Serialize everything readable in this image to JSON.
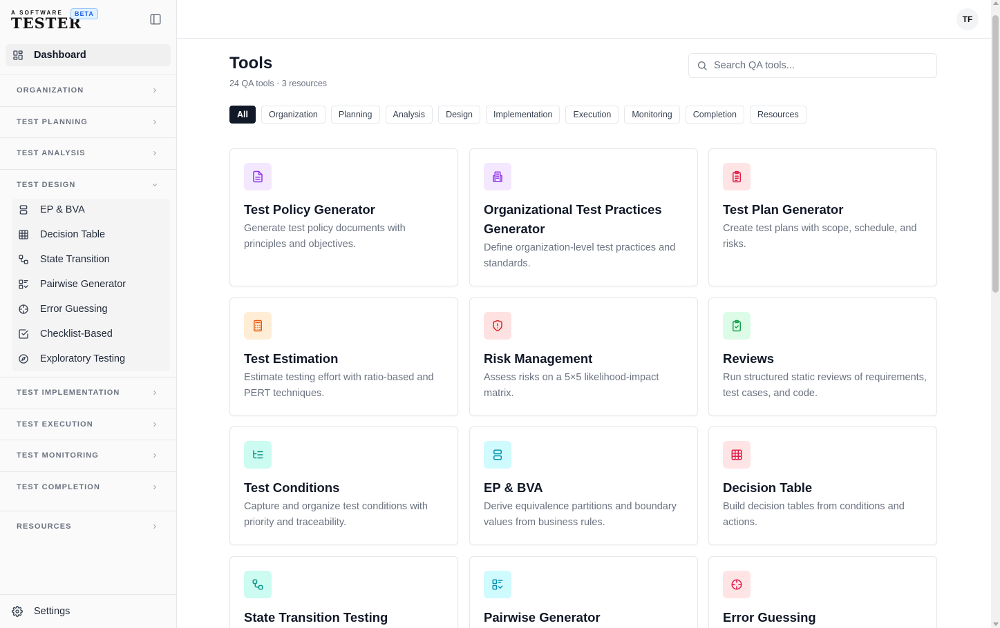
{
  "brand": {
    "top": "A SOFTWARE",
    "main": "TESTER",
    "badge": "BETA"
  },
  "sidebar": {
    "dashboard": "Dashboard",
    "sections": [
      {
        "label": "ORGANIZATION"
      },
      {
        "label": "TEST PLANNING"
      },
      {
        "label": "TEST ANALYSIS"
      },
      {
        "label": "TEST DESIGN"
      },
      {
        "label": "TEST IMPLEMENTATION"
      },
      {
        "label": "TEST EXECUTION"
      },
      {
        "label": "TEST MONITORING"
      },
      {
        "label": "TEST COMPLETION"
      },
      {
        "label": "RESOURCES"
      }
    ],
    "design_items": [
      {
        "label": "EP & BVA"
      },
      {
        "label": "Decision Table"
      },
      {
        "label": "State Transition"
      },
      {
        "label": "Pairwise Generator"
      },
      {
        "label": "Error Guessing"
      },
      {
        "label": "Checklist-Based"
      },
      {
        "label": "Exploratory Testing"
      }
    ],
    "settings": "Settings"
  },
  "header": {
    "avatar": "TF"
  },
  "main": {
    "title": "Tools",
    "subtitle": "24 QA tools · 3 resources",
    "search_placeholder": "Search QA tools...",
    "filters": [
      "All",
      "Organization",
      "Planning",
      "Analysis",
      "Design",
      "Implementation",
      "Execution",
      "Monitoring",
      "Completion",
      "Resources"
    ],
    "cards": [
      {
        "title": "Test Policy Generator",
        "desc": "Generate test policy documents with principles and objectives."
      },
      {
        "title": "Organizational Test Practices Generator",
        "desc": "Define organization-level test practices and standards."
      },
      {
        "title": "Test Plan Generator",
        "desc": "Create test plans with scope, schedule, and risks."
      },
      {
        "title": "Test Estimation",
        "desc": "Estimate testing effort with ratio-based and PERT techniques."
      },
      {
        "title": "Risk Management",
        "desc": "Assess risks on a 5×5 likelihood-impact matrix."
      },
      {
        "title": "Reviews",
        "desc": "Run structured static reviews of requirements, test cases, and code."
      },
      {
        "title": "Test Conditions",
        "desc": "Capture and organize test conditions with priority and traceability."
      },
      {
        "title": "EP & BVA",
        "desc": "Derive equivalence partitions and boundary values from business rules."
      },
      {
        "title": "Decision Table",
        "desc": "Build decision tables from conditions and actions."
      },
      {
        "title": "State Transition Testing",
        "desc": ""
      },
      {
        "title": "Pairwise Generator",
        "desc": ""
      },
      {
        "title": "Error Guessing",
        "desc": ""
      }
    ]
  },
  "colors": {
    "purple_bg": "#f3e8ff",
    "purple": "#9333ea",
    "rose_bg": "#ffe4e6",
    "rose": "#e11d48",
    "orange_bg": "#ffedd5",
    "orange": "#ea580c",
    "red_bg": "#fee2e2",
    "red": "#dc2626",
    "green_bg": "#dcfce7",
    "green": "#16a34a",
    "teal_bg": "#ccfbf1",
    "teal": "#0d9488",
    "cyan_bg": "#cffafe",
    "cyan": "#0891b2"
  }
}
